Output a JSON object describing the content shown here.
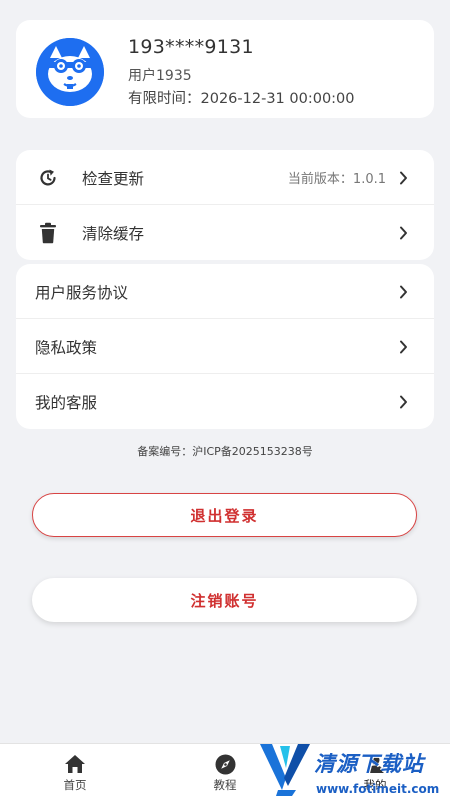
{
  "profile": {
    "phone": "193****9131",
    "name": "用户1935",
    "expire_label": "有限时间：",
    "expire_value": "2026-12-31 00:00:00",
    "avatar_icon": "raccoon-avatar-icon"
  },
  "settings_group1": [
    {
      "icon": "refresh-icon",
      "label": "检查更新",
      "value": "当前版本：1.0.1"
    },
    {
      "icon": "trash-icon",
      "label": "清除缓存",
      "value": ""
    }
  ],
  "settings_group2": [
    {
      "label": "用户服务协议"
    },
    {
      "label": "隐私政策"
    },
    {
      "label": "我的客服"
    }
  ],
  "icp_text": "备案编号：沪ICP备2025153238号",
  "buttons": {
    "logout": "退出登录",
    "cancel_account": "注销账号"
  },
  "tabbar": [
    {
      "icon": "home-icon",
      "label": "首页"
    },
    {
      "icon": "compass-icon",
      "label": "教程"
    },
    {
      "icon": "user-icon",
      "label": "我的"
    }
  ],
  "watermark": {
    "title": "清源下载站",
    "url": "www.fotimeit.com"
  },
  "colors": {
    "accent_red": "#d03030",
    "avatar_blue": "#1e6ef0",
    "background": "#f1f2f5"
  }
}
